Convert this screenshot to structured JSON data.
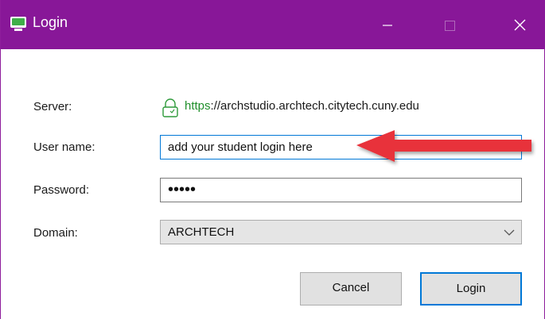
{
  "window": {
    "title": "Login",
    "accent_color": "#881798"
  },
  "form": {
    "server_label": "Server:",
    "server_scheme": "https",
    "server_rest": "://archstudio.archtech.citytech.cuny.edu",
    "username_label": "User name:",
    "username_value": "add your student login here",
    "password_label": "Password:",
    "password_value": "•••••",
    "domain_label": "Domain:",
    "domain_value": "ARCHTECH"
  },
  "buttons": {
    "cancel_label": "Cancel",
    "login_label": "Login"
  },
  "annotation": {
    "arrow_color": "#e8333a"
  },
  "icons": [
    "app-icon",
    "minimize-icon",
    "maximize-icon",
    "close-icon",
    "lock-icon",
    "chevron-down-icon",
    "arrow-annotation"
  ]
}
